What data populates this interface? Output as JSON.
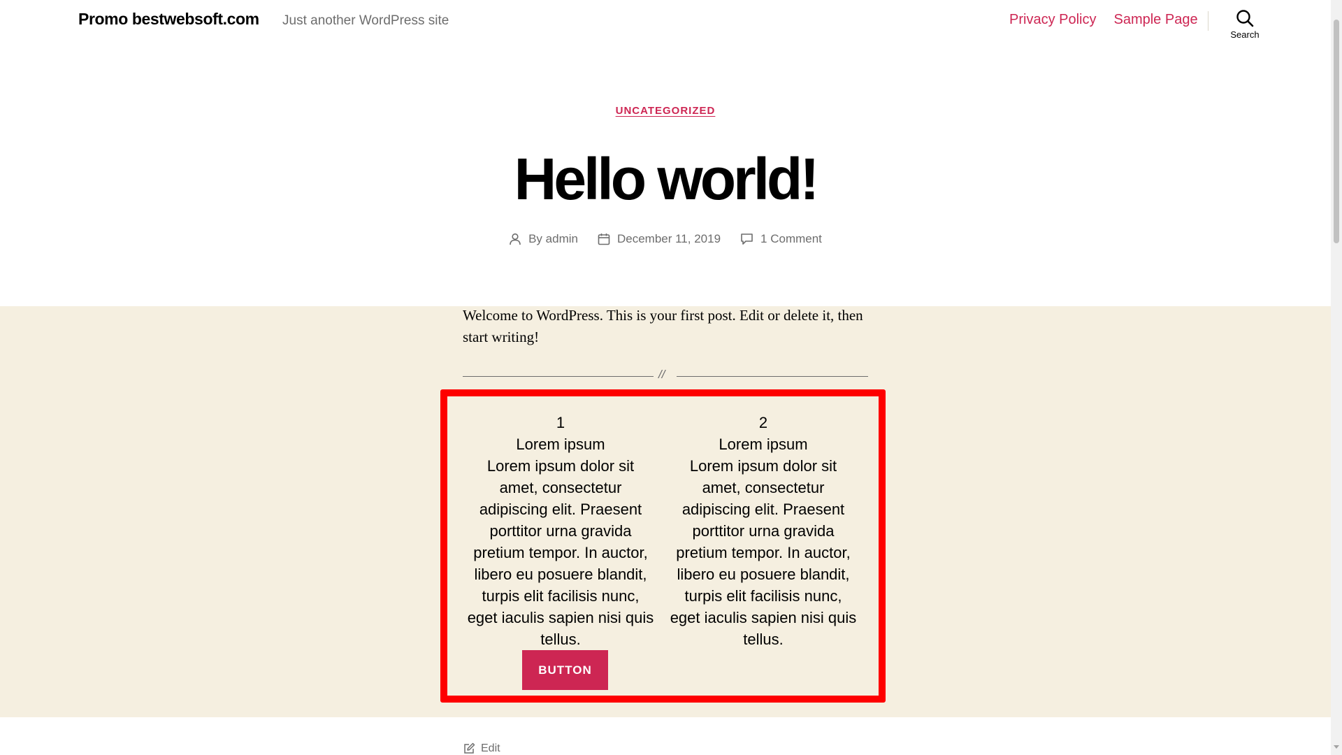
{
  "header": {
    "site_title": "Promo bestwebsoft.com",
    "site_description": "Just another WordPress site",
    "menu": [
      {
        "label": "Privacy Policy"
      },
      {
        "label": "Sample Page"
      }
    ],
    "search_label": "Search"
  },
  "post": {
    "category": "UNCATEGORIZED",
    "title": "Hello world!",
    "author": "By admin",
    "date": "December 11, 2019",
    "comments": "1 Comment",
    "intro": "Welcome to WordPress. This is your first post. Edit or delete it, then start writing!",
    "separator": "//",
    "columns": [
      {
        "number": "1",
        "heading": "Lorem ipsum",
        "text": "Lorem ipsum dolor sit amet, consectetur adipiscing elit. Praesent porttitor urna gravida pretium tempor. In auctor, libero eu posuere blandit, turpis elit facilisis nunc, eget iaculis sapien nisi quis tellus."
      },
      {
        "number": "2",
        "heading": "Lorem ipsum",
        "text": "Lorem ipsum dolor sit amet, consectetur adipiscing elit. Praesent porttitor urna gravida pretium tempor. In auctor, libero eu posuere blandit, turpis elit facilisis nunc, eget iaculis sapien nisi quis tellus."
      }
    ],
    "button_label": "BUTTON",
    "edit_label": "Edit"
  },
  "colors": {
    "accent": "#cd2653",
    "band": "#f5efe0",
    "highlight_border": "#fe0000"
  }
}
